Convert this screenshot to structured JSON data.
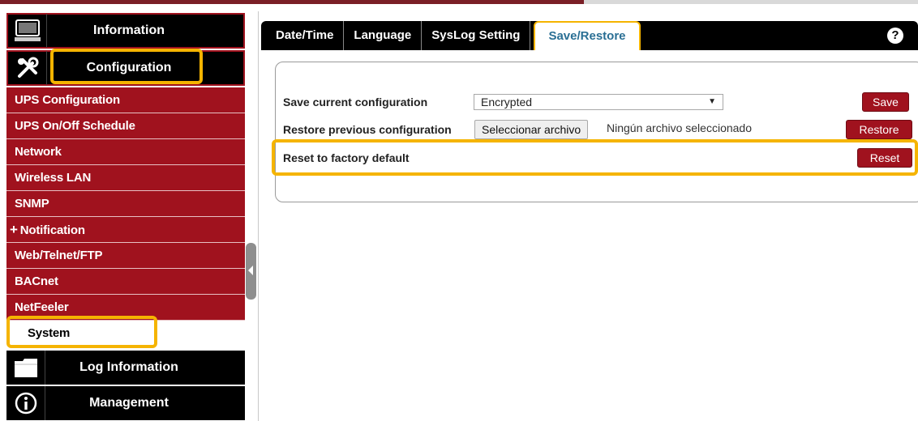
{
  "sidebar": {
    "headers": {
      "information": "Information",
      "configuration": "Configuration",
      "log_information": "Log Information",
      "management": "Management"
    },
    "items": [
      {
        "label": "UPS Configuration"
      },
      {
        "label": "UPS On/Off Schedule"
      },
      {
        "label": "Network"
      },
      {
        "label": "Wireless LAN"
      },
      {
        "label": "SNMP"
      },
      {
        "label": "Notification",
        "prefix": "+"
      },
      {
        "label": "Web/Telnet/FTP"
      },
      {
        "label": "BACnet"
      },
      {
        "label": "NetFeeler"
      },
      {
        "label": "System"
      }
    ],
    "icons": [
      "computer-icon",
      "tools-icon",
      "folder-icon",
      "info-icon"
    ]
  },
  "tabs": [
    "Date/Time",
    "Language",
    "SysLog Setting",
    "Save/Restore"
  ],
  "active_tab": "Save/Restore",
  "help_symbol": "?",
  "save_restore": {
    "save_label": "Save current configuration",
    "save_select_value": "Encrypted",
    "save_button": "Save",
    "restore_label": "Restore previous configuration",
    "file_button": "Seleccionar archivo",
    "file_status": "Ningún archivo seleccionado",
    "restore_button": "Restore",
    "reset_label": "Reset to factory default",
    "reset_button": "Reset"
  },
  "colors": {
    "accent_red": "#a0121e",
    "highlight": "#f5b400",
    "active_tab_text": "#2a6f94"
  }
}
